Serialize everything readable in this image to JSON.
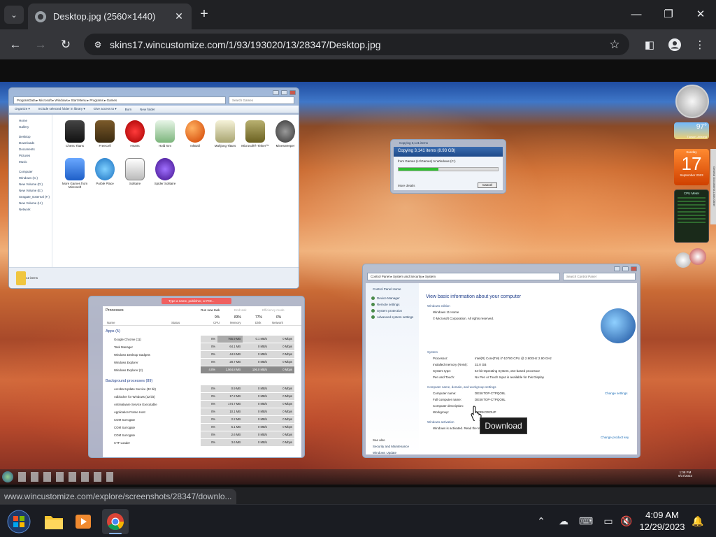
{
  "browser": {
    "tab_title": "Desktop.jpg (2560×1440)",
    "url": "skins17.wincustomize.com/1/93/193020/13/28347/Desktop.jpg",
    "status_url": "www.wincustomize.com/explore/screenshots/28347/downlo..."
  },
  "explorer": {
    "address": "ProgramData ▸ Microsoft ▸ Windows ▸ Start Menu ▸ Programs ▸ Games",
    "search": "Search Games",
    "commands": [
      "Organize ▾",
      "Include selected folder in library ▾",
      "Give access to ▾",
      "Burn",
      "New folder"
    ],
    "tree": [
      "Home",
      "Gallery",
      "Desktop",
      "Downloads",
      "Documents",
      "Pictures",
      "Music",
      "Computer",
      "Windows (C:)",
      "New Volume (D:)",
      "New Volume (E:)",
      "Seagate_External (F:)",
      "New Volume (H:)",
      "Network"
    ],
    "items": [
      "Chess Titans",
      "FreeCell",
      "Hearts",
      "Hold 'Em",
      "InkBall",
      "Mahjong Titans",
      "Microsoft® Tinker™",
      "Minesweeper",
      "More Games from Microsoft",
      "Purble Place",
      "Solitaire",
      "Spider Solitaire"
    ],
    "item_count": "12 items"
  },
  "copy_dialog": {
    "title": "Copying 3,141 items",
    "heading": "Copying 3,141 items (8.93 GB)",
    "from_to": "from Games (H:\\Games) to Windows (C:)",
    "more": "More details",
    "cancel": "Cancel",
    "progress": 0.4
  },
  "taskmgr": {
    "search": "Type a name, publisher, or PID...",
    "tab": "Processes",
    "run_task": "Run new task",
    "end_task": "End task",
    "efficiency": "Efficiency mode",
    "headers": {
      "name": "Name",
      "status": "Status",
      "cpu": "CPU",
      "memory": "Memory",
      "disk": "Disk",
      "network": "Network"
    },
    "totals": {
      "cpu": "9%",
      "memory": "83%",
      "disk": "77%",
      "network": "0%"
    },
    "apps_group": "Apps (5)",
    "apps": [
      {
        "name": "Google Chrome (11)",
        "cpu": "0%",
        "mem": "765.9 MB",
        "disk": "0.1 MB/s",
        "net": "0 Mbps"
      },
      {
        "name": "Task Manager",
        "cpu": "0%",
        "mem": "64.1 MB",
        "disk": "0 MB/s",
        "net": "0 Mbps"
      },
      {
        "name": "Windows Desktop Gadgets",
        "cpu": "0%",
        "mem": "44.9 MB",
        "disk": "0 MB/s",
        "net": "0 Mbps"
      },
      {
        "name": "Windows Explorer",
        "cpu": "0%",
        "mem": "28.7 MB",
        "disk": "0 MB/s",
        "net": "0 Mbps"
      },
      {
        "name": "Windows Explorer (2)",
        "cpu": "4.0%",
        "mem": "1,564.8 MB",
        "disk": "106.0 MB/s",
        "net": "0 Mbps"
      }
    ],
    "bg_group": "Background processes (89)",
    "bg": [
      {
        "name": "Acrobat Update Service (32 bit)",
        "cpu": "0%",
        "mem": "0.9 MB",
        "disk": "0 MB/s",
        "net": "0 Mbps"
      },
      {
        "name": "Adblocker for Windows (32 bit)",
        "cpu": "0%",
        "mem": "17.2 MB",
        "disk": "0 MB/s",
        "net": "0 Mbps"
      },
      {
        "name": "Antimalware Service Executable",
        "cpu": "0%",
        "mem": "174.7 MB",
        "disk": "0 MB/s",
        "net": "0 Mbps"
      },
      {
        "name": "Application Frame Host",
        "cpu": "0%",
        "mem": "10.1 MB",
        "disk": "0 MB/s",
        "net": "0 Mbps"
      },
      {
        "name": "COM Surrogate",
        "cpu": "0%",
        "mem": "2.2 MB",
        "disk": "0 MB/s",
        "net": "0 Mbps"
      },
      {
        "name": "COM Surrogate",
        "cpu": "0%",
        "mem": "5.1 MB",
        "disk": "0 MB/s",
        "net": "0 Mbps"
      },
      {
        "name": "COM Surrogate",
        "cpu": "0%",
        "mem": "2.6 MB",
        "disk": "0 MB/s",
        "net": "0 Mbps"
      },
      {
        "name": "CTF Loader",
        "cpu": "0%",
        "mem": "3.6 MB",
        "disk": "0 MB/s",
        "net": "0 Mbps"
      }
    ]
  },
  "system": {
    "address": "Control Panel ▸ System and Security ▸ System",
    "search": "Search Control Panel",
    "home": "Control Panel Home",
    "links": [
      "Device Manager",
      "Remote settings",
      "System protection",
      "Advanced system settings"
    ],
    "heading": "View basic information about your computer",
    "edition_label": "Windows edition",
    "edition": "Windows 11 Home",
    "copyright": "© Microsoft Corporation. All rights reserved.",
    "system_label": "System",
    "rows": [
      {
        "k": "Processor:",
        "v": "Intel(R) Core(TM) i7-10700 CPU @ 2.90GHz   2.90 GHz"
      },
      {
        "k": "Installed memory (RAM):",
        "v": "32.0 GB"
      },
      {
        "k": "System type:",
        "v": "64-bit Operating System, x64-based processor"
      },
      {
        "k": "Pen and Touch:",
        "v": "No Pen or Touch Input is available for this Display"
      }
    ],
    "cn_label": "Computer name, domain, and workgroup settings",
    "cn_rows": [
      {
        "k": "Computer name:",
        "v": "DESKTOP-CTPQO8L"
      },
      {
        "k": "Full computer name:",
        "v": "DESKTOP-CTPQO8L"
      },
      {
        "k": "Computer description:",
        "v": ""
      },
      {
        "k": "Workgroup:",
        "v": "WORKGROUP"
      }
    ],
    "change_settings": "Change settings",
    "activation_label": "Windows activation",
    "activation": "Windows is activated.  Read the Microsoft Software License Terms",
    "change_key": "Change product key",
    "see_also": "See also",
    "see_links": [
      "Security and Maintenance",
      "Windows Update"
    ]
  },
  "gadgets": {
    "temp": "97°",
    "weather_loc": "Tucson, Arizona",
    "cal_day": "Sunday",
    "cal_date": "17",
    "cal_month": "September 2023",
    "cpu_meter": "CPU Meter",
    "side_tabs": [
      "General",
      "Documents",
      "Links",
      "Other"
    ]
  },
  "inner_clock": {
    "time": "1:08 PM",
    "date": "9/17/2023"
  },
  "tooltip": "Download",
  "taskbar": {
    "time": "4:09 AM",
    "date": "12/29/2023"
  },
  "colors": {
    "accent": "#8ab4f8",
    "chrome_dark": "#202124",
    "chrome_mid": "#35363a"
  }
}
